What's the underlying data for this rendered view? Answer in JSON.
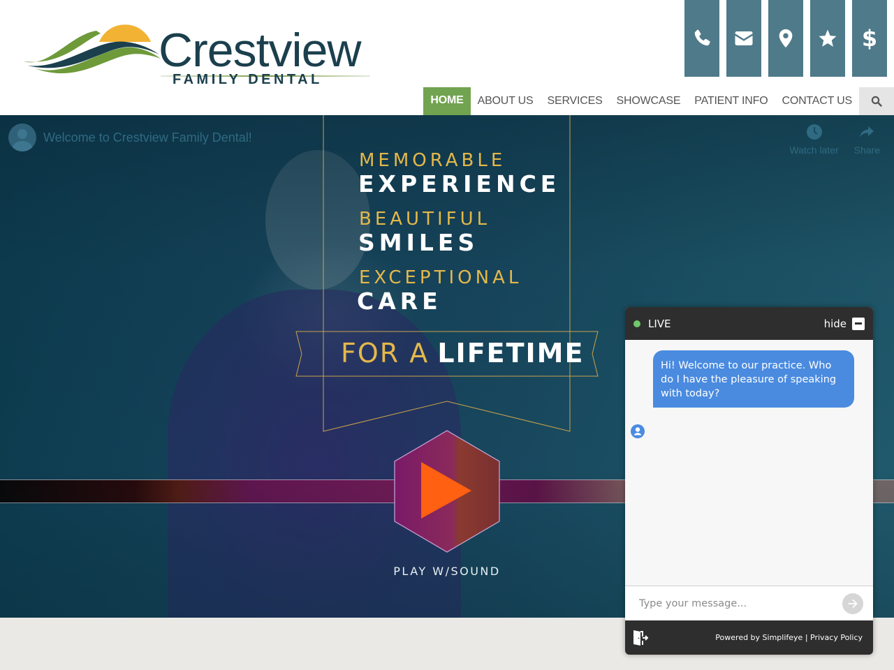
{
  "brand": {
    "name": "Crestview",
    "subtitle": "FAMILY DENTAL",
    "colors": {
      "navy": "#1b3f4d",
      "green": "#72a350",
      "gold": "#f2b233",
      "slate": "#4f7a8a"
    }
  },
  "quick_icons": [
    {
      "name": "phone-icon",
      "label": "Phone"
    },
    {
      "name": "email-icon",
      "label": "Email"
    },
    {
      "name": "location-icon",
      "label": "Location"
    },
    {
      "name": "star-icon",
      "label": "Reviews"
    },
    {
      "name": "dollar-icon",
      "label": "$"
    }
  ],
  "nav": {
    "items": [
      {
        "label": "HOME",
        "active": true
      },
      {
        "label": "ABOUT US"
      },
      {
        "label": "SERVICES"
      },
      {
        "label": "SHOWCASE"
      },
      {
        "label": "PATIENT INFO"
      },
      {
        "label": "CONTACT US"
      }
    ],
    "search_icon": "search-icon"
  },
  "video": {
    "title": "Welcome to Crestview Family Dental!",
    "watch_later": "Watch later",
    "share": "Share",
    "taglines": [
      {
        "light": "MEMORABLE",
        "bold": "EXPERIENCE"
      },
      {
        "light": "BEAUTIFUL",
        "bold": "SMILES"
      },
      {
        "light": "EXCEPTIONAL",
        "bold": "CARE"
      }
    ],
    "banner": {
      "light": "FOR A",
      "bold": "LIFETIME"
    },
    "play_label": "PLAY W/SOUND"
  },
  "chat": {
    "status": "LIVE",
    "hide_label": "hide",
    "message": "Hi! Welcome to our practice.  Who do I have the pleasure of speaking with today?",
    "input_placeholder": "Type your message...",
    "powered_by": "Powered by Simplifeye",
    "separator": " | ",
    "privacy": "Privacy Policy"
  }
}
